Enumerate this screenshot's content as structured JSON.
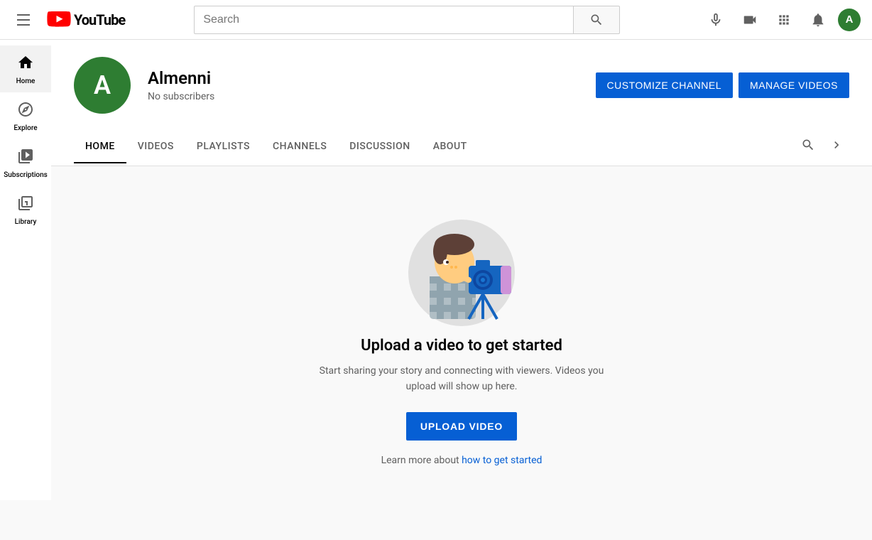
{
  "header": {
    "search_placeholder": "Search",
    "logo_text": "YouTube"
  },
  "sidebar": {
    "items": [
      {
        "id": "home",
        "label": "Home",
        "icon": "⌂",
        "active": true
      },
      {
        "id": "explore",
        "label": "Explore",
        "icon": "🔍"
      },
      {
        "id": "subscriptions",
        "label": "Subscriptions",
        "icon": "▶"
      },
      {
        "id": "library",
        "label": "Library",
        "icon": "📋"
      }
    ]
  },
  "channel": {
    "avatar_letter": "A",
    "name": "Almenni",
    "subscribers": "No subscribers",
    "customize_label": "CUSTOMIZE CHANNEL",
    "manage_label": "MANAGE VIDEOS",
    "tabs": [
      {
        "id": "home",
        "label": "HOME",
        "active": true
      },
      {
        "id": "videos",
        "label": "VIDEOS",
        "active": false
      },
      {
        "id": "playlists",
        "label": "PLAYLISTS",
        "active": false
      },
      {
        "id": "channels",
        "label": "CHANNELS",
        "active": false
      },
      {
        "id": "discussion",
        "label": "DISCUSSION",
        "active": false
      },
      {
        "id": "about",
        "label": "ABOUT",
        "active": false
      }
    ]
  },
  "empty_state": {
    "title": "Upload a video to get started",
    "subtitle": "Start sharing your story and connecting with viewers. Videos you upload will show up here.",
    "upload_label": "UPLOAD VIDEO",
    "learn_more_text": "Learn more about ",
    "learn_more_link": "how to get started"
  }
}
